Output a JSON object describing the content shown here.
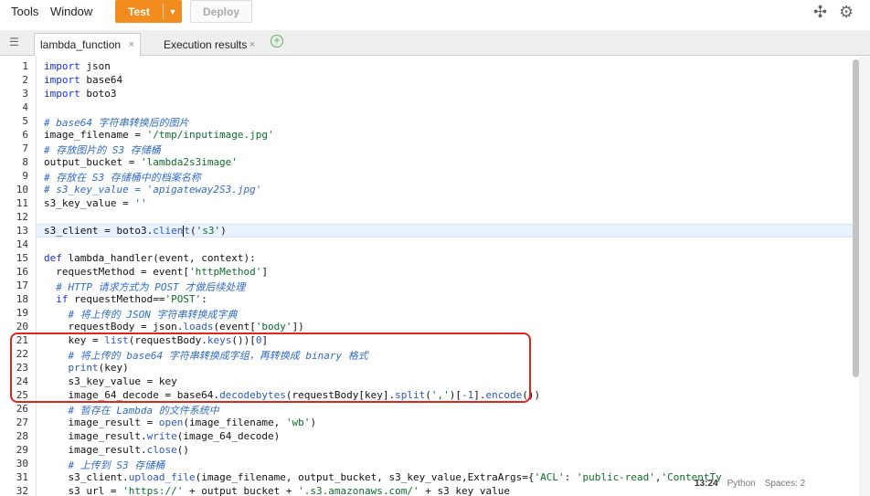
{
  "menu": {
    "tools": "Tools",
    "window": "Window"
  },
  "toolbar": {
    "test_label": "Test",
    "test_caret": "▼",
    "deploy_label": "Deploy"
  },
  "topright": {
    "move_icon": "✣",
    "settings_icon": "⚙"
  },
  "tabs": [
    {
      "label": "lambda_function",
      "close": "×"
    },
    {
      "label": "Execution results",
      "close": "×"
    }
  ],
  "add_tab": "+",
  "status": {
    "time": "13:24",
    "lang": "Python",
    "spaces": "Spaces: 2"
  },
  "lines": [
    {
      "n": "1",
      "tokens": [
        {
          "t": "k",
          "v": "import"
        },
        {
          "t": "",
          "v": " json"
        }
      ]
    },
    {
      "n": "2",
      "tokens": [
        {
          "t": "k",
          "v": "import"
        },
        {
          "t": "",
          "v": " base64"
        }
      ]
    },
    {
      "n": "3",
      "tokens": [
        {
          "t": "k",
          "v": "import"
        },
        {
          "t": "",
          "v": " boto3"
        }
      ]
    },
    {
      "n": "4",
      "tokens": []
    },
    {
      "n": "5",
      "tokens": [
        {
          "t": "c",
          "v": "# base64 字符串转换后的图片"
        }
      ]
    },
    {
      "n": "6",
      "tokens": [
        {
          "t": "",
          "v": "image_filename = "
        },
        {
          "t": "s",
          "v": "'/tmp/inputimage.jpg'"
        }
      ]
    },
    {
      "n": "7",
      "tokens": [
        {
          "t": "c",
          "v": "# 存放图片的 S3 存储桶"
        }
      ]
    },
    {
      "n": "8",
      "tokens": [
        {
          "t": "",
          "v": "output_bucket = "
        },
        {
          "t": "s",
          "v": "'lambda2s3image'"
        }
      ]
    },
    {
      "n": "9",
      "tokens": [
        {
          "t": "c",
          "v": "# 存放在 S3 存储桶中的档案名称"
        }
      ]
    },
    {
      "n": "10",
      "tokens": [
        {
          "t": "c",
          "v": "# s3_key_value = 'apigateway2S3.jpg'"
        }
      ]
    },
    {
      "n": "11",
      "tokens": [
        {
          "t": "",
          "v": "s3_key_value = "
        },
        {
          "t": "s",
          "v": "''"
        }
      ]
    },
    {
      "n": "12",
      "tokens": []
    },
    {
      "n": "13",
      "tokens": [
        {
          "t": "",
          "v": "s3_client = boto3."
        },
        {
          "t": "f",
          "v": "clien"
        },
        {
          "t": "cursor",
          "v": ""
        },
        {
          "t": "f",
          "v": "t"
        },
        {
          "t": "",
          "v": "("
        },
        {
          "t": "s",
          "v": "'s3'"
        },
        {
          "t": "",
          "v": ")"
        }
      ]
    },
    {
      "n": "14",
      "tokens": []
    },
    {
      "n": "15",
      "tokens": [
        {
          "t": "k",
          "v": "def"
        },
        {
          "t": "",
          "v": " lambda_handler(event, context):"
        }
      ]
    },
    {
      "n": "16",
      "tokens": [
        {
          "t": "",
          "v": "  requestMethod = event["
        },
        {
          "t": "s",
          "v": "'httpMethod'"
        },
        {
          "t": "",
          "v": "]"
        }
      ]
    },
    {
      "n": "17",
      "tokens": [
        {
          "t": "c",
          "v": "  # HTTP 请求方式为 POST 才做后续处理"
        }
      ]
    },
    {
      "n": "18",
      "tokens": [
        {
          "t": "k",
          "v": "  if"
        },
        {
          "t": "",
          "v": " requestMethod=="
        },
        {
          "t": "s",
          "v": "'POST'"
        },
        {
          "t": "",
          "v": ":"
        }
      ]
    },
    {
      "n": "19",
      "tokens": [
        {
          "t": "c",
          "v": "    # 将上传的 JSON 字符串转换成字典"
        }
      ]
    },
    {
      "n": "20",
      "tokens": [
        {
          "t": "",
          "v": "    requestBody = json."
        },
        {
          "t": "f",
          "v": "loads"
        },
        {
          "t": "",
          "v": "(event["
        },
        {
          "t": "s",
          "v": "'body'"
        },
        {
          "t": "",
          "v": "])"
        }
      ]
    },
    {
      "n": "21",
      "tokens": [
        {
          "t": "",
          "v": "    key = "
        },
        {
          "t": "f",
          "v": "list"
        },
        {
          "t": "",
          "v": "(requestBody."
        },
        {
          "t": "f",
          "v": "keys"
        },
        {
          "t": "",
          "v": "())["
        },
        {
          "t": "f",
          "v": "0"
        },
        {
          "t": "",
          "v": "]"
        }
      ]
    },
    {
      "n": "22",
      "tokens": [
        {
          "t": "c",
          "v": "    # 将上传的 base64 字符串转换成字组，再转换成 binary 格式"
        }
      ]
    },
    {
      "n": "23",
      "tokens": [
        {
          "t": "f",
          "v": "    print"
        },
        {
          "t": "",
          "v": "(key)"
        }
      ]
    },
    {
      "n": "24",
      "tokens": [
        {
          "t": "",
          "v": "    s3_key_value = key"
        }
      ]
    },
    {
      "n": "25",
      "tokens": [
        {
          "t": "",
          "v": "    image_64_decode = base64."
        },
        {
          "t": "f",
          "v": "decodebytes"
        },
        {
          "t": "",
          "v": "(requestBody[key]."
        },
        {
          "t": "f",
          "v": "split"
        },
        {
          "t": "",
          "v": "("
        },
        {
          "t": "s",
          "v": "','"
        },
        {
          "t": "",
          "v": ")["
        },
        {
          "t": "f",
          "v": "-1"
        },
        {
          "t": "",
          "v": "]."
        },
        {
          "t": "f",
          "v": "encode"
        },
        {
          "t": "",
          "v": "())"
        }
      ]
    },
    {
      "n": "26",
      "tokens": [
        {
          "t": "c",
          "v": "    # 暂存在 Lambda 的文件系统中"
        }
      ]
    },
    {
      "n": "27",
      "tokens": [
        {
          "t": "",
          "v": "    image_result = "
        },
        {
          "t": "f",
          "v": "open"
        },
        {
          "t": "",
          "v": "(image_filename, "
        },
        {
          "t": "s",
          "v": "'wb'"
        },
        {
          "t": "",
          "v": ")"
        }
      ]
    },
    {
      "n": "28",
      "tokens": [
        {
          "t": "",
          "v": "    image_result."
        },
        {
          "t": "f",
          "v": "write"
        },
        {
          "t": "",
          "v": "(image_64_decode)"
        }
      ]
    },
    {
      "n": "29",
      "tokens": [
        {
          "t": "",
          "v": "    image_result."
        },
        {
          "t": "f",
          "v": "close"
        },
        {
          "t": "",
          "v": "()"
        }
      ]
    },
    {
      "n": "30",
      "tokens": [
        {
          "t": "c",
          "v": "    # 上传到 S3 存储桶"
        }
      ]
    },
    {
      "n": "31",
      "tokens": [
        {
          "t": "",
          "v": "    s3_client."
        },
        {
          "t": "f",
          "v": "upload_file"
        },
        {
          "t": "",
          "v": "(image_filename, output_bucket, s3_key_value,ExtraArgs={"
        },
        {
          "t": "s",
          "v": "'ACL'"
        },
        {
          "t": "",
          "v": ": "
        },
        {
          "t": "s",
          "v": "'public-read'"
        },
        {
          "t": "",
          "v": ","
        },
        {
          "t": "s",
          "v": "'ContentTy"
        }
      ]
    },
    {
      "n": "32",
      "tokens": [
        {
          "t": "",
          "v": "    s3_url = "
        },
        {
          "t": "s",
          "v": "'https://'"
        },
        {
          "t": "",
          "v": " + output_bucket + "
        },
        {
          "t": "s",
          "v": "'.s3.amazonaws.com/'"
        },
        {
          "t": "",
          "v": " + s3_key_value"
        }
      ]
    }
  ]
}
